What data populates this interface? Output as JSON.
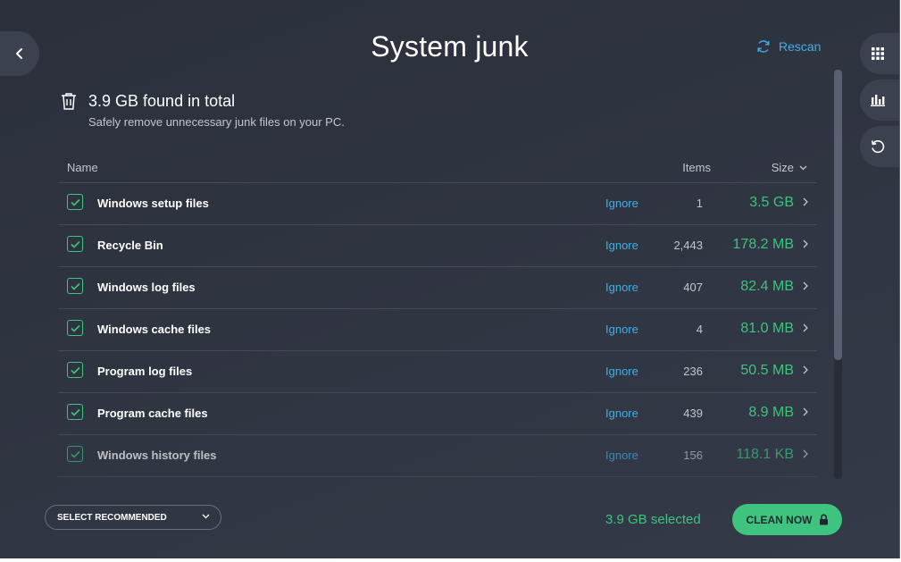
{
  "header": {
    "title": "System junk",
    "rescan_label": "Rescan"
  },
  "summary": {
    "total": "3.9 GB found in total",
    "subtitle": "Safely remove unnecessary junk files on your PC."
  },
  "table": {
    "columns": {
      "name": "Name",
      "items": "Items",
      "size": "Size"
    },
    "rows": [
      {
        "name": "Windows setup files",
        "ignore": "Ignore",
        "items": "1",
        "size": "3.5 GB",
        "checked": true
      },
      {
        "name": "Recycle Bin",
        "ignore": "Ignore",
        "items": "2,443",
        "size": "178.2 MB",
        "checked": true
      },
      {
        "name": "Windows log files",
        "ignore": "Ignore",
        "items": "407",
        "size": "82.4 MB",
        "checked": true
      },
      {
        "name": "Windows cache files",
        "ignore": "Ignore",
        "items": "4",
        "size": "81.0 MB",
        "checked": true
      },
      {
        "name": "Program log files",
        "ignore": "Ignore",
        "items": "236",
        "size": "50.5 MB",
        "checked": true
      },
      {
        "name": "Program cache files",
        "ignore": "Ignore",
        "items": "439",
        "size": "8.9 MB",
        "checked": true
      },
      {
        "name": "Windows history files",
        "ignore": "Ignore",
        "items": "156",
        "size": "118.1 KB",
        "checked": true
      }
    ]
  },
  "footer": {
    "select_recommended": "SELECT RECOMMENDED",
    "selected_total": "3.9 GB selected",
    "clean_label": "CLEAN NOW"
  },
  "icons": {
    "back": "chevron-left-icon",
    "rescan": "refresh-icon",
    "apps": "grid-icon",
    "stats": "bar-chart-icon",
    "history": "undo-history-icon",
    "trash": "trash-icon",
    "lock": "lock-icon"
  },
  "colors": {
    "background": "#2f3441",
    "accent_green": "#3ec47e",
    "link_blue": "#3fb0e8",
    "text_primary": "#ffffff",
    "text_secondary": "#c2c6ce"
  }
}
